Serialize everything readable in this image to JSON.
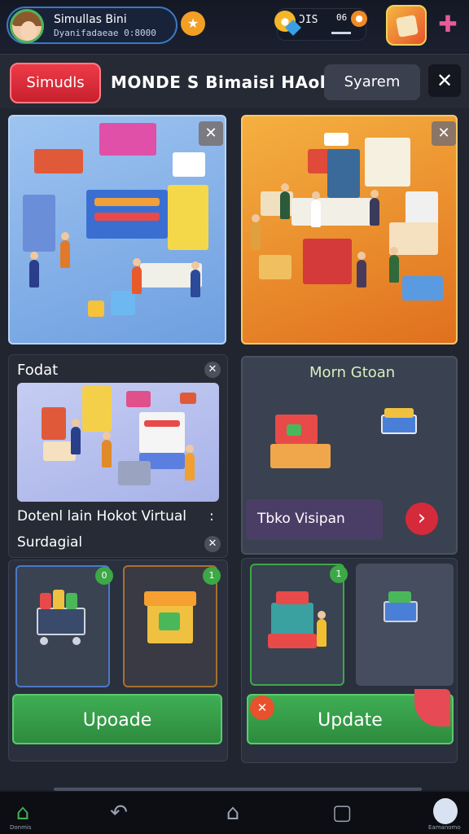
{
  "header": {
    "profile_name": "Simullas Bini",
    "profile_sub": "Dyanifadaeae 0:8000",
    "currency_value": "ƆIS",
    "currency_value2": "06",
    "icons": [
      "star-icon",
      "coin-icon",
      "gem-icon",
      "cube-icon",
      "tools-icon"
    ]
  },
  "tabs": {
    "simulasi": "Simudls",
    "title": "MONDE S Bimaisi HAol",
    "sistem": "Syarem",
    "close": "✕"
  },
  "cards": {
    "top_left_close": "✕",
    "top_right_close": "✕",
    "feature_title": "Fodat",
    "feature_close": "✕",
    "feature_desc_line1": "Dotenl lain Hokot Virtual",
    "feature_desc_more": ":",
    "feature_desc_line2": "Surdagial",
    "feature_desc_close": "✕",
    "moun_title": "Morn Gtoan",
    "visit_label": "Tbko Visipan",
    "visit_arrow": "›",
    "update_left": "Upoade",
    "update_right": "Update",
    "badge1": "0",
    "badge2": "1",
    "badge3": "1",
    "x_icon": "✕"
  },
  "nav": {
    "home_label": "Donmis",
    "profile_label": "Eamanomo"
  },
  "colors": {
    "accent_red": "#e53442",
    "accent_green": "#3fae54",
    "panel_bg": "#20252f"
  }
}
